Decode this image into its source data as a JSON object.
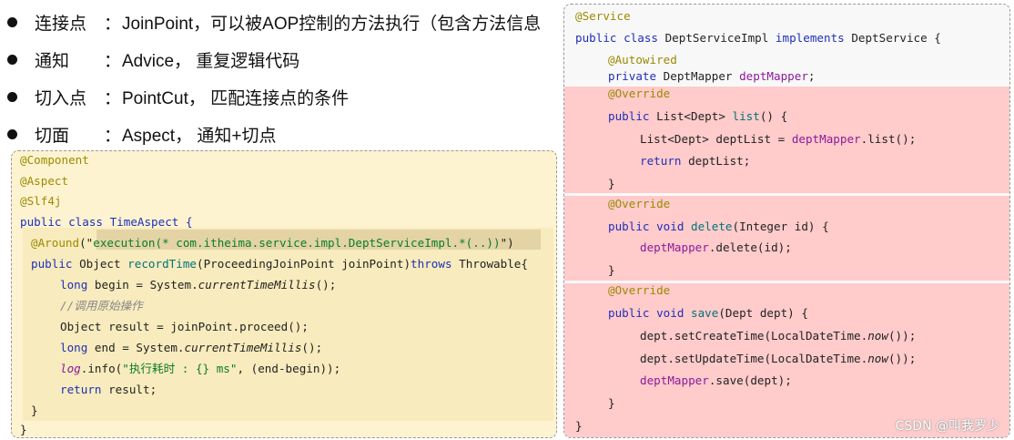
{
  "bullets": [
    {
      "term": "连接点",
      "colon": "：",
      "desc": "JoinPoint，可以被AOP控制的方法执行（包含方法信息"
    },
    {
      "term": "通知",
      "colon": "：",
      "desc": "Advice， 重复逻辑代码"
    },
    {
      "term": "切入点",
      "colon": "：",
      "desc": "PointCut， 匹配连接点的条件"
    },
    {
      "term": "切面",
      "colon": "：",
      "desc": "Aspect， 通知+切点"
    }
  ],
  "left_code": {
    "ann_component": "@Component",
    "ann_aspect": "@Aspect",
    "ann_slf4j": "@Slf4j",
    "class_decl": "public class TimeAspect {",
    "around_ann": "@Around",
    "around_open": "(\"",
    "around_expr": "execution(* com.itheima.service.impl.DeptServiceImpl.*(..))",
    "around_close": "\")",
    "method_kw": "public",
    "method_ret": " Object ",
    "method_name": "recordTime",
    "method_params": "(ProceedingJoinPoint joinPoint)",
    "method_throws": "throws",
    "method_tail": " Throwable{",
    "begin_kw": "long",
    "begin_rest": " begin = System.",
    "begin_call": "currentTimeMillis",
    "begin_end": "();",
    "comment": "//调用原始操作",
    "result_line": "Object result = joinPoint.proceed();",
    "end_kw": "long",
    "end_rest": " end = System.",
    "end_call": "currentTimeMillis",
    "end_end": "();",
    "log_obj": "log",
    "log_info": ".info(",
    "log_str": "\"执行耗时 : {} ms\"",
    "log_tail": ", (end-begin));",
    "return_kw": "return",
    "return_rest": " result;",
    "close_inner": "}",
    "close_outer": "}"
  },
  "right_code": {
    "ann_service": "@Service",
    "class_kw1": "public class ",
    "class_name": "DeptServiceImpl ",
    "class_kw2": "implements ",
    "class_tail": "DeptService {",
    "ann_autowired": "@Autowired",
    "field_kw": "private ",
    "field_type": "DeptMapper ",
    "field_name": "deptMapper",
    "field_end": ";",
    "ann_override": "@Override",
    "list_kw": "public ",
    "list_type": "List<Dept> ",
    "list_name": "list",
    "list_tail": "() {",
    "list_body1a": "List<Dept> deptList = ",
    "list_body1b": "deptMapper",
    "list_body1c": ".list();",
    "list_return_kw": "return ",
    "list_return_rest": "deptList;",
    "close": "}",
    "del_kw": "public void ",
    "del_name": "delete",
    "del_tail": "(Integer id) {",
    "del_body_a": "deptMapper",
    "del_body_b": ".delete(id);",
    "save_kw": "public void ",
    "save_name": "save",
    "save_tail": "(Dept dept) {",
    "save_l1a": "dept.setCreateTime(LocalDateTime.",
    "save_l1b": "now",
    "save_l1c": "());",
    "save_l2a": "dept.setUpdateTime(LocalDateTime.",
    "save_l2b": "now",
    "save_l2c": "());",
    "save_l3a": "deptMapper",
    "save_l3b": ".save(dept);"
  },
  "watermark": "CSDN @叫我罗少",
  "colors": {
    "annotation": "#9b8a00",
    "keyword": "#1f2fb8",
    "field": "#8b1a9a",
    "pink_highlight": "#ffcbcb",
    "yellow_panel": "#fdf3d0"
  }
}
